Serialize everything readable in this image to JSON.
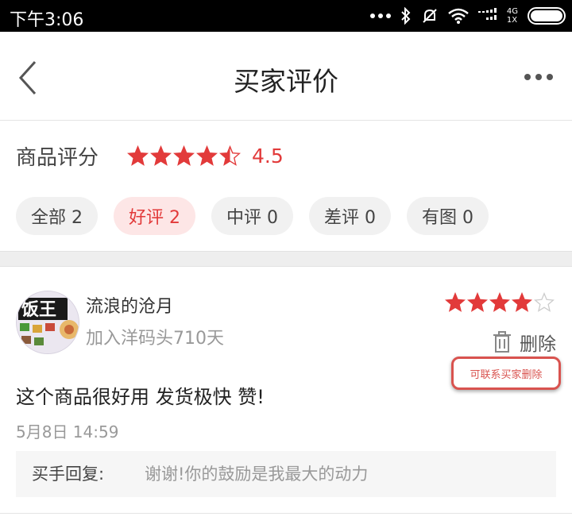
{
  "status_bar": {
    "time": "下午3:06",
    "network_top": "4G",
    "network_bottom": "1X",
    "icons": [
      "more-dots-icon",
      "bluetooth-icon",
      "mute-icon",
      "wifi-icon",
      "signal-icon",
      "battery-icon"
    ]
  },
  "header": {
    "title": "买家评价",
    "back_icon": "back-arrow-icon",
    "more_icon": "more-dots-icon"
  },
  "rating": {
    "label": "商品评分",
    "score": "4.5",
    "stars_filled": 4.5,
    "star_color": "#e23a3a"
  },
  "filters": [
    {
      "label": "全部 2",
      "active": false
    },
    {
      "label": "好评 2",
      "active": true
    },
    {
      "label": "中评 0",
      "active": false
    },
    {
      "label": "差评 0",
      "active": false
    },
    {
      "label": "有图 0",
      "active": false
    }
  ],
  "review": {
    "avatar_text": "饭王",
    "username": "流浪的沧月",
    "join_info": "加入洋码头710天",
    "stars": 4,
    "delete_label": "删除",
    "callout": "可联系买家删除",
    "content": "这个商品很好用 发货极快 赞!",
    "time": "5月8日 14:59",
    "reply_prefix": "买手回复:",
    "reply_text": "谢谢!你的鼓励是我最大的动力"
  },
  "colors": {
    "accent": "#e23a3a",
    "chip_bg": "#f1f1f1",
    "chip_active_bg": "#fde6e6",
    "callout_border": "#d9534f"
  }
}
